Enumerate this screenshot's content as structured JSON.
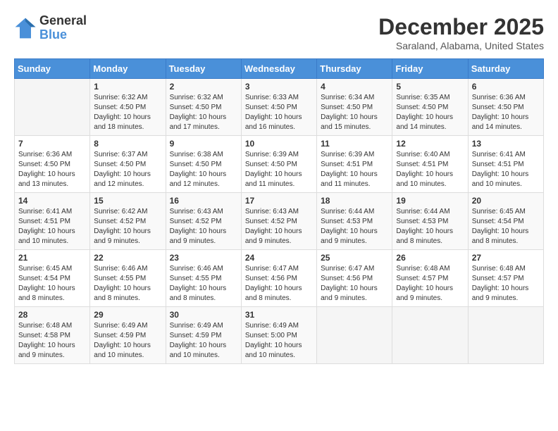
{
  "logo": {
    "general": "General",
    "blue": "Blue"
  },
  "header": {
    "month": "December 2025",
    "location": "Saraland, Alabama, United States"
  },
  "days_of_week": [
    "Sunday",
    "Monday",
    "Tuesday",
    "Wednesday",
    "Thursday",
    "Friday",
    "Saturday"
  ],
  "weeks": [
    [
      {
        "day": "",
        "info": ""
      },
      {
        "day": "1",
        "info": "Sunrise: 6:32 AM\nSunset: 4:50 PM\nDaylight: 10 hours\nand 18 minutes."
      },
      {
        "day": "2",
        "info": "Sunrise: 6:32 AM\nSunset: 4:50 PM\nDaylight: 10 hours\nand 17 minutes."
      },
      {
        "day": "3",
        "info": "Sunrise: 6:33 AM\nSunset: 4:50 PM\nDaylight: 10 hours\nand 16 minutes."
      },
      {
        "day": "4",
        "info": "Sunrise: 6:34 AM\nSunset: 4:50 PM\nDaylight: 10 hours\nand 15 minutes."
      },
      {
        "day": "5",
        "info": "Sunrise: 6:35 AM\nSunset: 4:50 PM\nDaylight: 10 hours\nand 14 minutes."
      },
      {
        "day": "6",
        "info": "Sunrise: 6:36 AM\nSunset: 4:50 PM\nDaylight: 10 hours\nand 14 minutes."
      }
    ],
    [
      {
        "day": "7",
        "info": "Sunrise: 6:36 AM\nSunset: 4:50 PM\nDaylight: 10 hours\nand 13 minutes."
      },
      {
        "day": "8",
        "info": "Sunrise: 6:37 AM\nSunset: 4:50 PM\nDaylight: 10 hours\nand 12 minutes."
      },
      {
        "day": "9",
        "info": "Sunrise: 6:38 AM\nSunset: 4:50 PM\nDaylight: 10 hours\nand 12 minutes."
      },
      {
        "day": "10",
        "info": "Sunrise: 6:39 AM\nSunset: 4:50 PM\nDaylight: 10 hours\nand 11 minutes."
      },
      {
        "day": "11",
        "info": "Sunrise: 6:39 AM\nSunset: 4:51 PM\nDaylight: 10 hours\nand 11 minutes."
      },
      {
        "day": "12",
        "info": "Sunrise: 6:40 AM\nSunset: 4:51 PM\nDaylight: 10 hours\nand 10 minutes."
      },
      {
        "day": "13",
        "info": "Sunrise: 6:41 AM\nSunset: 4:51 PM\nDaylight: 10 hours\nand 10 minutes."
      }
    ],
    [
      {
        "day": "14",
        "info": "Sunrise: 6:41 AM\nSunset: 4:51 PM\nDaylight: 10 hours\nand 10 minutes."
      },
      {
        "day": "15",
        "info": "Sunrise: 6:42 AM\nSunset: 4:52 PM\nDaylight: 10 hours\nand 9 minutes."
      },
      {
        "day": "16",
        "info": "Sunrise: 6:43 AM\nSunset: 4:52 PM\nDaylight: 10 hours\nand 9 minutes."
      },
      {
        "day": "17",
        "info": "Sunrise: 6:43 AM\nSunset: 4:52 PM\nDaylight: 10 hours\nand 9 minutes."
      },
      {
        "day": "18",
        "info": "Sunrise: 6:44 AM\nSunset: 4:53 PM\nDaylight: 10 hours\nand 9 minutes."
      },
      {
        "day": "19",
        "info": "Sunrise: 6:44 AM\nSunset: 4:53 PM\nDaylight: 10 hours\nand 8 minutes."
      },
      {
        "day": "20",
        "info": "Sunrise: 6:45 AM\nSunset: 4:54 PM\nDaylight: 10 hours\nand 8 minutes."
      }
    ],
    [
      {
        "day": "21",
        "info": "Sunrise: 6:45 AM\nSunset: 4:54 PM\nDaylight: 10 hours\nand 8 minutes."
      },
      {
        "day": "22",
        "info": "Sunrise: 6:46 AM\nSunset: 4:55 PM\nDaylight: 10 hours\nand 8 minutes."
      },
      {
        "day": "23",
        "info": "Sunrise: 6:46 AM\nSunset: 4:55 PM\nDaylight: 10 hours\nand 8 minutes."
      },
      {
        "day": "24",
        "info": "Sunrise: 6:47 AM\nSunset: 4:56 PM\nDaylight: 10 hours\nand 8 minutes."
      },
      {
        "day": "25",
        "info": "Sunrise: 6:47 AM\nSunset: 4:56 PM\nDaylight: 10 hours\nand 9 minutes."
      },
      {
        "day": "26",
        "info": "Sunrise: 6:48 AM\nSunset: 4:57 PM\nDaylight: 10 hours\nand 9 minutes."
      },
      {
        "day": "27",
        "info": "Sunrise: 6:48 AM\nSunset: 4:57 PM\nDaylight: 10 hours\nand 9 minutes."
      }
    ],
    [
      {
        "day": "28",
        "info": "Sunrise: 6:48 AM\nSunset: 4:58 PM\nDaylight: 10 hours\nand 9 minutes."
      },
      {
        "day": "29",
        "info": "Sunrise: 6:49 AM\nSunset: 4:59 PM\nDaylight: 10 hours\nand 10 minutes."
      },
      {
        "day": "30",
        "info": "Sunrise: 6:49 AM\nSunset: 4:59 PM\nDaylight: 10 hours\nand 10 minutes."
      },
      {
        "day": "31",
        "info": "Sunrise: 6:49 AM\nSunset: 5:00 PM\nDaylight: 10 hours\nand 10 minutes."
      },
      {
        "day": "",
        "info": ""
      },
      {
        "day": "",
        "info": ""
      },
      {
        "day": "",
        "info": ""
      }
    ]
  ]
}
